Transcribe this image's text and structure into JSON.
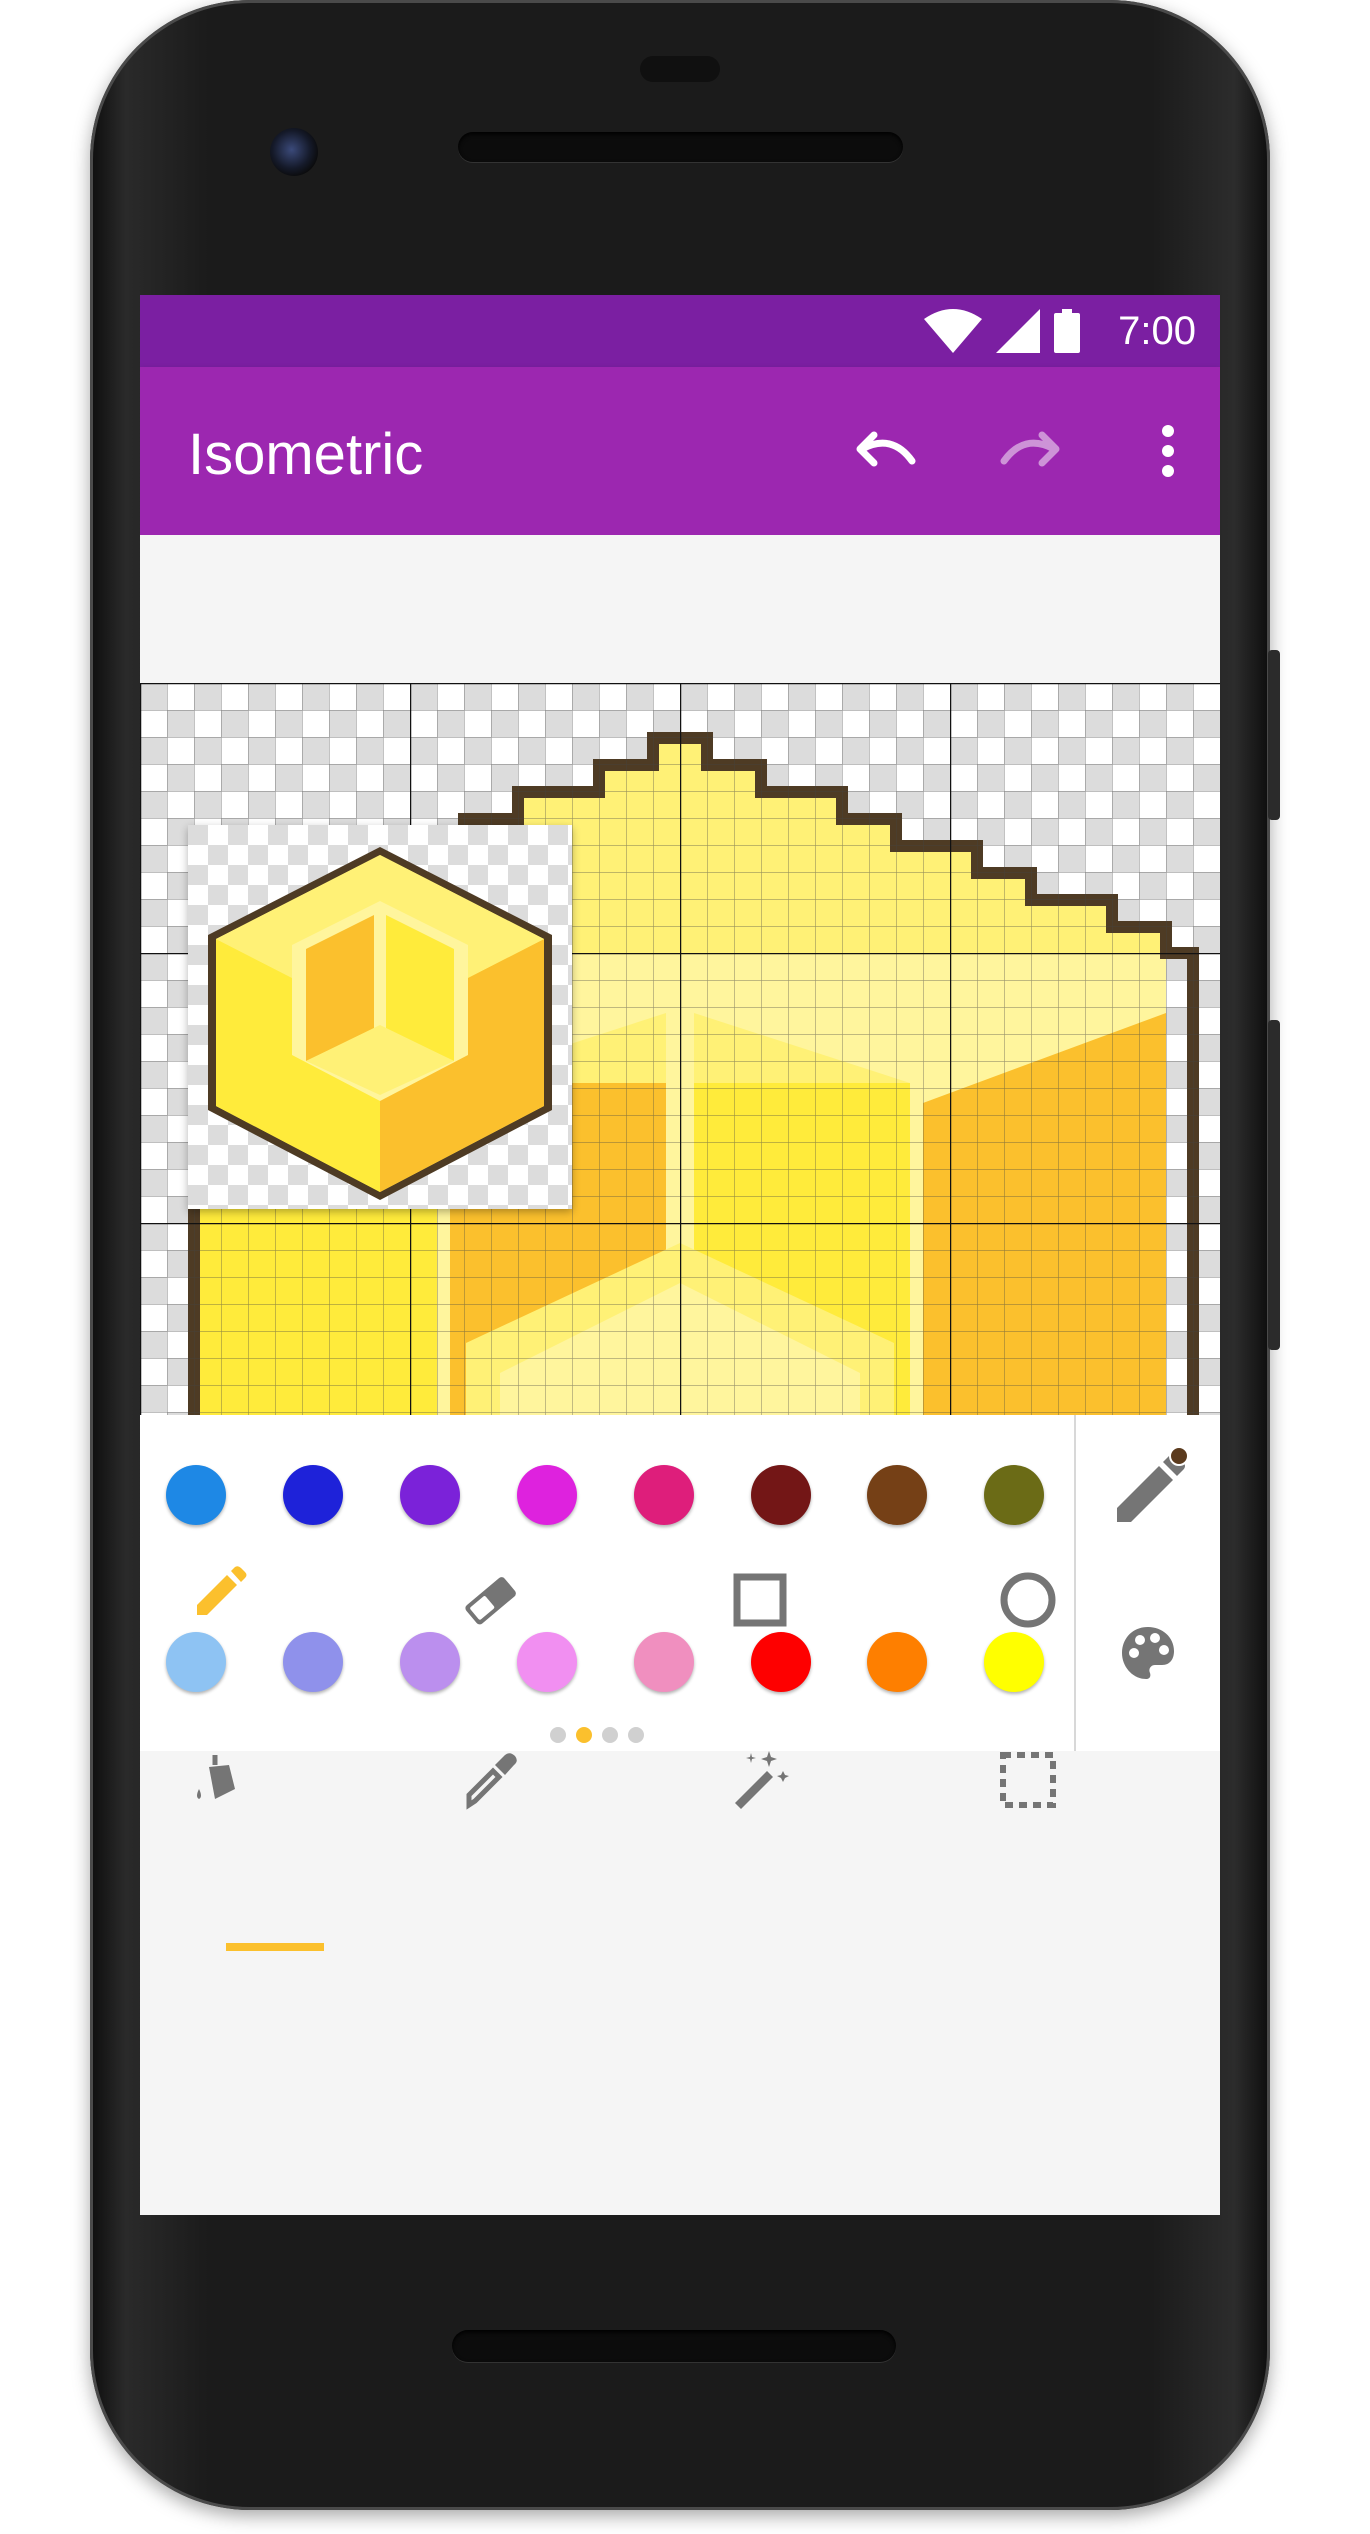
{
  "status_bar": {
    "time": "7:00"
  },
  "app_bar": {
    "title": "Isometric",
    "undo_icon": "undo-icon",
    "redo_icon": "redo-icon",
    "menu_icon": "more-vert-icon"
  },
  "palette": {
    "row1": [
      "#1e88e5",
      "#1e22d9",
      "#7b22d9",
      "#de22de",
      "#de1e7b",
      "#731616",
      "#754016",
      "#6b6b16"
    ],
    "row2": [
      "#8ec3f3",
      "#8f91eb",
      "#bb8fee",
      "#f18ff1",
      "#f08fbf",
      "#fe0000",
      "#fe7f00",
      "#ffff00"
    ],
    "page_count": 4,
    "active_page": 1,
    "side_tools": [
      "pencil-color-icon",
      "palette-icon"
    ]
  },
  "tools": {
    "row1": [
      "pencil-icon",
      "eraser-icon",
      "square-icon",
      "circle-icon"
    ],
    "row2": [
      "fill-bucket-icon",
      "eyedropper-icon",
      "magic-wand-icon",
      "selection-icon"
    ],
    "active": "pencil-icon"
  },
  "colors": {
    "accent": "#fbc02d",
    "app_bar": "#9c27b0",
    "status_bar": "#7b1fa2",
    "icon_gray": "#757575",
    "yellow_light": "#fff176",
    "yellow_mid": "#ffeb3b",
    "yellow_dark": "#fbc02d",
    "outline": "#4e3b24"
  }
}
